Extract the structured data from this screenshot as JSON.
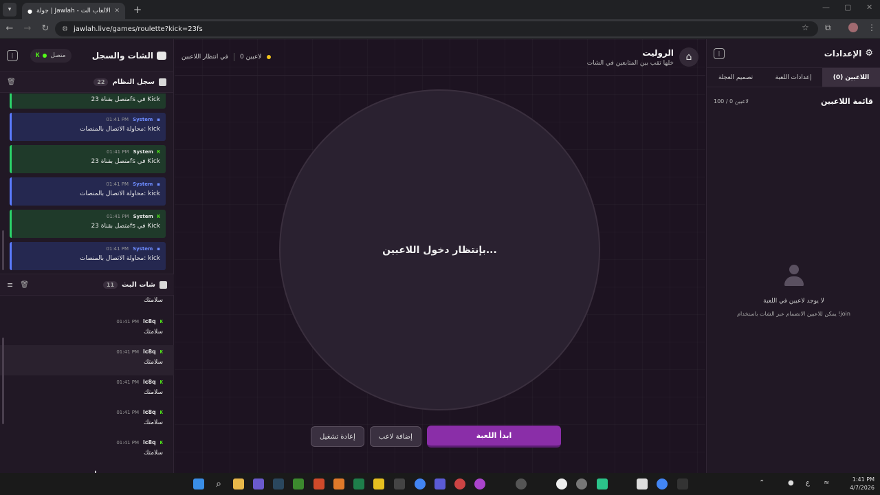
{
  "browser": {
    "tab_title": "جولة | Jawlah - منصة الألعاب الت...",
    "url": "jawlah.live/games/roulette?kick=23fs",
    "new_tab": "+",
    "wc_min": "—",
    "wc_max": "▢",
    "wc_close": "✕"
  },
  "left_panel": {
    "title": "الشات والسجل",
    "status_label": "متصل",
    "system_log": {
      "title": "سجل النظام",
      "count": "22",
      "items": [
        {
          "source": "System",
          "time": "01:41 PM",
          "text": "متصل بقناة 23fs في Kick",
          "kind": "kick"
        },
        {
          "source": "System",
          "time": "01:41 PM",
          "text": "محاولة الاتصال بالمنصات: kick",
          "kind": "system"
        },
        {
          "source": "System",
          "time": "01:41 PM",
          "text": "متصل بقناة 23fs في Kick",
          "kind": "kick"
        },
        {
          "source": "System",
          "time": "01:41 PM",
          "text": "محاولة الاتصال بالمنصات: kick",
          "kind": "system"
        },
        {
          "source": "System",
          "time": "01:41 PM",
          "text": "متصل بقناة 23fs في Kick",
          "kind": "kick"
        },
        {
          "source": "System",
          "time": "01:41 PM",
          "text": "محاولة الاتصال بالمنصات: kick",
          "kind": "system"
        }
      ]
    },
    "live_chat": {
      "title": "شات البث",
      "count": "11",
      "partial_text": "سلامتك",
      "messages": [
        {
          "user": "lc8q",
          "time": "01:41 PM",
          "text": "سلامتك"
        },
        {
          "user": "lc8q",
          "time": "01:41 PM",
          "text": "سلامتك"
        },
        {
          "user": "lc8q",
          "time": "01:41 PM",
          "text": "سلامتك"
        },
        {
          "user": "lc8q",
          "time": "01:41 PM",
          "text": "سلامتك"
        },
        {
          "user": "lc8q",
          "time": "01:41 PM",
          "text": "سلامتك"
        }
      ]
    }
  },
  "center": {
    "game_title": "الروليت",
    "game_subtitle": "خلها تقب بين المتابعين في الشات",
    "player_count": "0 لاعبين",
    "status": "في انتظار اللاعبين",
    "wheel_text": "بإنتظار دخول اللاعبين...",
    "buttons": {
      "start": "ابدأ اللعبة",
      "add_player": "إضافة لاعب",
      "restart": "إعادة تشغيل"
    }
  },
  "right_panel": {
    "title": "الإعدادات",
    "tabs": [
      "اللاعبين (0)",
      "إعدادات اللعبة",
      "تصميم العجلة"
    ],
    "list_title": "قائمة اللاعبين",
    "list_count": "100 / 0 لاعبين",
    "empty_title": "لا يوجد لاعبين في اللعبة",
    "empty_subtitle": "يمكن للاعبين الانضمام عبر الشات باستخدام !join"
  },
  "taskbar": {
    "time": "1:41 PM",
    "date": "4/7/2026",
    "lang": "ع"
  },
  "colors": {
    "accent": "#8a2ea8",
    "kick_green": "#53fc18",
    "system_blue": "#5b7bff"
  }
}
